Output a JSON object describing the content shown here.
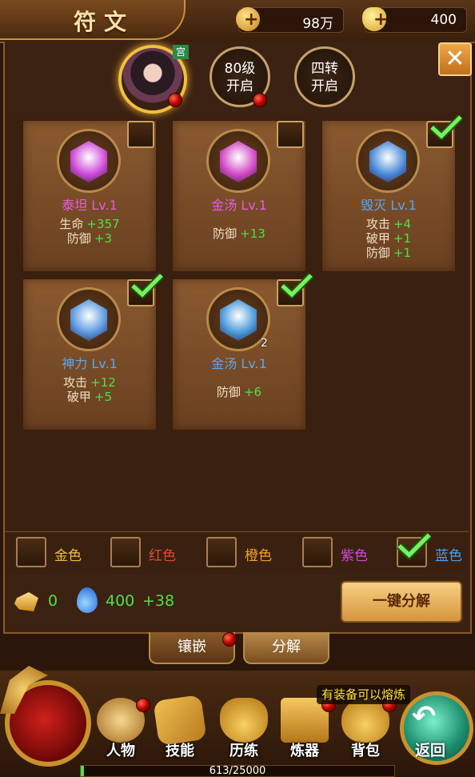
{
  "title": "符文",
  "currency": {
    "gold": "98万",
    "ingot": "400"
  },
  "heads": {
    "main_badge": "宫",
    "slot2_line1": "80级",
    "slot2_line2": "开启",
    "slot3_line1": "四转",
    "slot3_line2": "开启"
  },
  "runes": [
    {
      "name": "泰坦 Lv.1",
      "name_color": "#e85ae0",
      "stats": [
        {
          "label": "生命",
          "value": "+357"
        },
        {
          "label": "防御",
          "value": "+3"
        }
      ],
      "checked": false,
      "gem_color": "#d04ad8",
      "count": ""
    },
    {
      "name": "金汤 Lv.1",
      "name_color": "#e85ae0",
      "stats": [
        {
          "label": "防御",
          "value": "+13"
        }
      ],
      "checked": false,
      "gem_color": "#d44ac6",
      "count": ""
    },
    {
      "name": "毁灭 Lv.1",
      "name_color": "#5aa6f0",
      "stats": [
        {
          "label": "攻击",
          "value": "+4"
        },
        {
          "label": "破甲",
          "value": "+1"
        },
        {
          "label": "防御",
          "value": "+1"
        }
      ],
      "checked": true,
      "gem_color": "#4a8ad8",
      "count": ""
    },
    {
      "name": "神力 Lv.1",
      "name_color": "#5aa6f0",
      "stats": [
        {
          "label": "攻击",
          "value": "+12"
        },
        {
          "label": "破甲",
          "value": "+5"
        }
      ],
      "checked": true,
      "gem_color": "#5a9ae0",
      "count": ""
    },
    {
      "name": "金汤 Lv.1",
      "name_color": "#5aa6f0",
      "stats": [
        {
          "label": "防御",
          "value": "+6"
        }
      ],
      "checked": true,
      "gem_color": "#4a9ad8",
      "count": "2"
    }
  ],
  "filters": [
    {
      "label": "金色",
      "color": "#f0c040",
      "checked": false
    },
    {
      "label": "红色",
      "color": "#e04a3a",
      "checked": false
    },
    {
      "label": "橙色",
      "color": "#f0a030",
      "checked": false
    },
    {
      "label": "紫色",
      "color": "#d04ad8",
      "checked": false
    },
    {
      "label": "蓝色",
      "color": "#4aa0f0",
      "checked": true
    }
  ],
  "resources": {
    "shard": "0",
    "essence": "400",
    "essence_gain": "+38"
  },
  "decompose_label": "一键分解",
  "tabs": {
    "inlay": "镶嵌",
    "decompose": "分解"
  },
  "nav": {
    "character": "人物",
    "skills": "技能",
    "training": "历练",
    "forge": "炼器",
    "bag": "背包",
    "back": "返回",
    "forge_tip": "有装备可以熔炼"
  },
  "exp": "613/25000"
}
